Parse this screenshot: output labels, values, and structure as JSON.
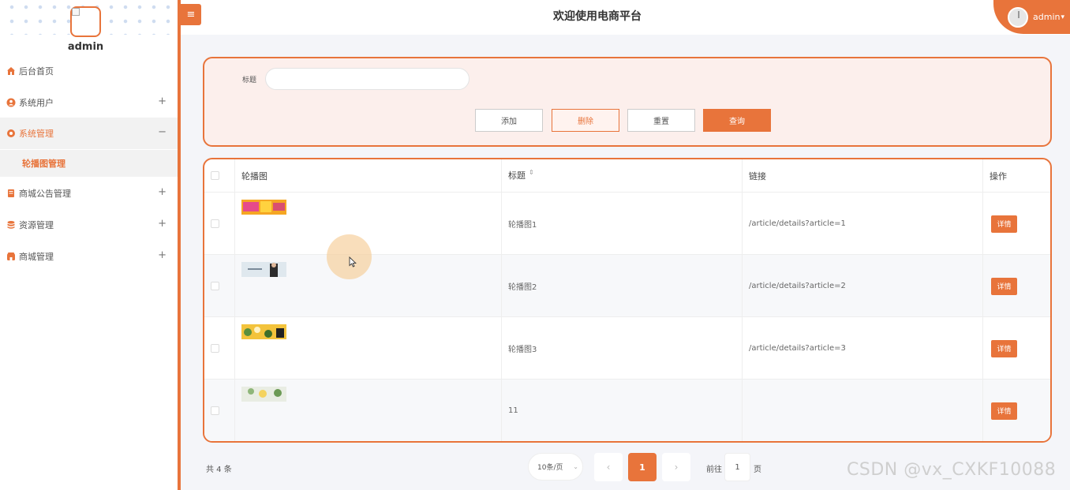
{
  "sidebar": {
    "username": "admin",
    "menu": [
      {
        "label": "后台首页",
        "icon": "home-icon",
        "expand": ""
      },
      {
        "label": "系统用户",
        "icon": "user-icon",
        "expand": "+"
      },
      {
        "label": "系统管理",
        "icon": "gear-icon",
        "expand": "−"
      },
      {
        "label": "商城公告管理",
        "icon": "notice-icon",
        "expand": "+"
      },
      {
        "label": "资源管理",
        "icon": "database-icon",
        "expand": "+"
      },
      {
        "label": "商城管理",
        "icon": "store-icon",
        "expand": "+"
      }
    ],
    "submenu": {
      "label": "轮播图管理"
    }
  },
  "header": {
    "menu_toggle": "≡",
    "title": "欢迎使用电商平台",
    "user": "admin",
    "caret": "▾"
  },
  "search": {
    "label": "标题",
    "value": "",
    "placeholder": ""
  },
  "buttons": {
    "add": "添加",
    "delete": "删除",
    "reset": "重置",
    "query": "查询"
  },
  "table": {
    "columns": [
      "轮播图",
      "标题",
      "链接",
      "操作"
    ],
    "sort_icon": "⇕",
    "rows": [
      {
        "title": "轮播图1",
        "link": "/article/details?article=1",
        "action": "详情"
      },
      {
        "title": "轮播图2",
        "link": "/article/details?article=2",
        "action": "详情"
      },
      {
        "title": "轮播图3",
        "link": "/article/details?article=3",
        "action": "详情"
      },
      {
        "title": "11",
        "link": "",
        "action": "详情"
      }
    ]
  },
  "pagination": {
    "total": "共 4 条",
    "page_size": "10条/页",
    "prev": "‹",
    "current": "1",
    "next": "›",
    "goto_label": "前往",
    "goto_value": "1",
    "goto_unit": "页"
  },
  "watermark": "CSDN @vx_CXKF10088",
  "colors": {
    "accent": "#e8743b",
    "panel_bg": "#fcefec"
  }
}
